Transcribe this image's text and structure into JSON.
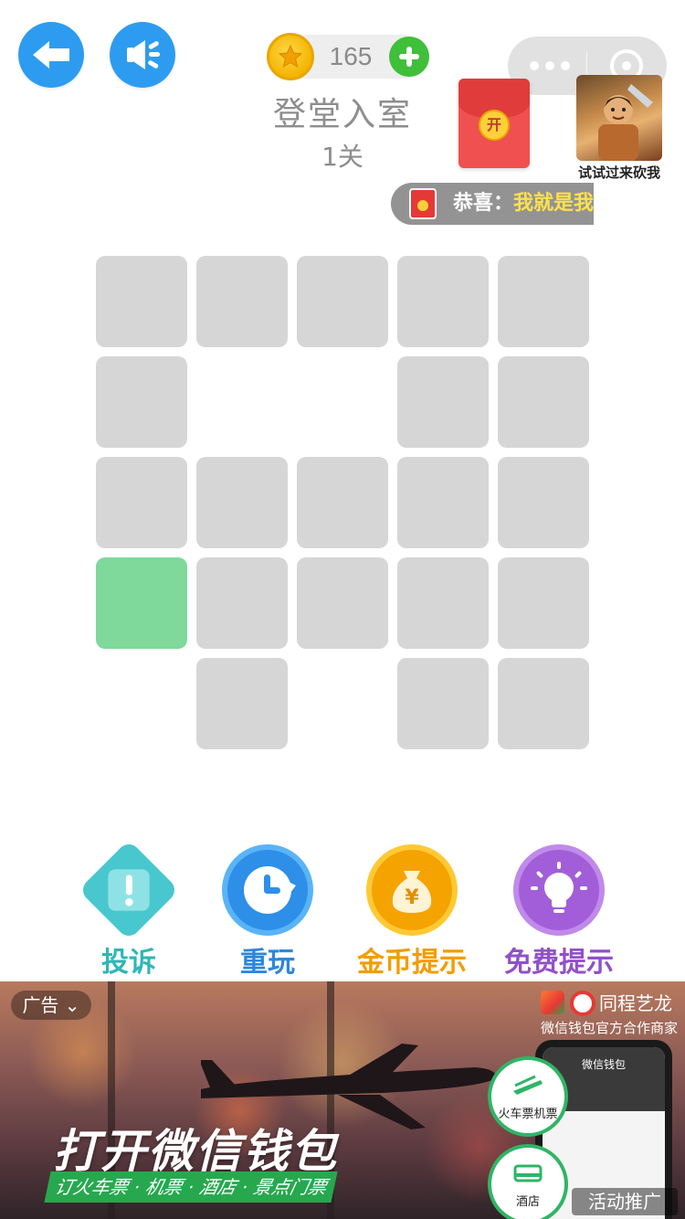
{
  "header": {
    "coins": "165",
    "level_title": "登堂入室",
    "level_number": "1关"
  },
  "red_envelope": {
    "seal_text": "开"
  },
  "game_ad": {
    "label": "试试过来砍我"
  },
  "ticker": {
    "prefix": "恭喜：",
    "highlight": "我就是我"
  },
  "grid": {
    "rows": [
      [
        "cell",
        "cell",
        "cell",
        "cell",
        "cell"
      ],
      [
        "cell",
        "empty",
        "empty",
        "cell",
        "cell"
      ],
      [
        "cell",
        "cell",
        "cell",
        "cell",
        "cell"
      ],
      [
        "green",
        "cell",
        "cell",
        "cell",
        "cell"
      ],
      [
        "empty",
        "cell",
        "empty",
        "cell",
        "cell"
      ]
    ]
  },
  "actions": [
    {
      "label": "投诉",
      "icon": "warning-icon",
      "color": "#49c7cf"
    },
    {
      "label": "重玩",
      "icon": "replay-clock-icon",
      "color": "#2d8fe8"
    },
    {
      "label": "金币提示",
      "icon": "money-bag-icon",
      "color": "#f5a300"
    },
    {
      "label": "免费提示",
      "icon": "lightbulb-icon",
      "color": "#a25ed8"
    }
  ],
  "ad": {
    "tag": "广告",
    "brand": "同程艺龙",
    "partner": "微信钱包官方合作商家",
    "phone_title": "微信钱包",
    "bubble1": "火车票机票",
    "bubble2": "酒店",
    "headline": "打开微信钱包",
    "sub": "订火车票 · 机票 · 酒店 · 景点门票",
    "promo": "活动推广"
  }
}
